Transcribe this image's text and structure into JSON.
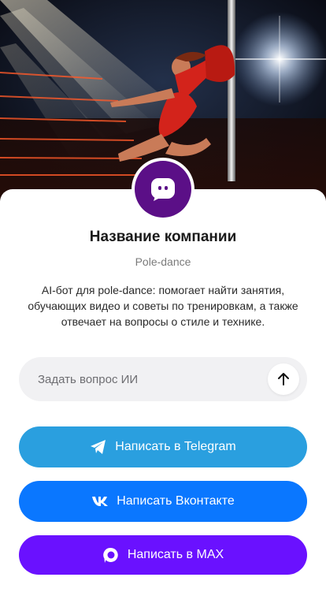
{
  "hero": {
    "image": "pole-dancer-stage-photo",
    "alt": ""
  },
  "company": {
    "name": "Название компании",
    "category": "Pole-dance",
    "description": "AI-бот для pole-dance: помогает найти занятия, обучающих видео и советы по тренировкам, а также отвечает на вопросы о стиле и технике.",
    "avatar_icon": "chat-bot-icon",
    "avatar_color": "#5b0f87"
  },
  "ask": {
    "placeholder": "Задать вопрос ИИ",
    "value": "",
    "send_icon": "arrow-up-icon"
  },
  "actions": [
    {
      "label": "Написать в Telegram",
      "icon": "telegram-icon",
      "color": "#2a9fdf"
    },
    {
      "label": "Написать Вконтакте",
      "icon": "vk-icon",
      "color": "#0a77ff"
    },
    {
      "label": "Написать в MAX",
      "icon": "max-icon",
      "color": "#6a11ff"
    }
  ]
}
